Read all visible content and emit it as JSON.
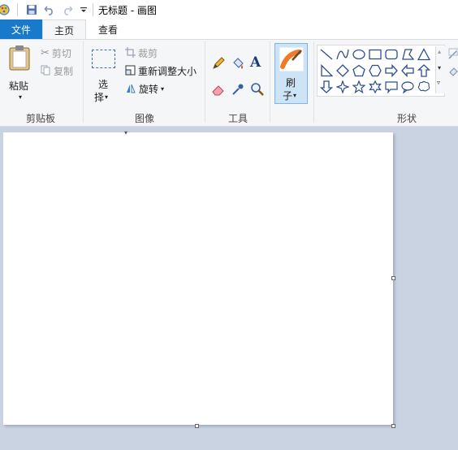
{
  "window": {
    "title": "无标题 - 画图"
  },
  "tabs": {
    "file": "文件",
    "home": "主页",
    "view": "查看"
  },
  "clipboard": {
    "paste": "粘贴",
    "cut": "剪切",
    "copy": "复制",
    "group": "剪贴板"
  },
  "image": {
    "select_line1": "选",
    "select_line2": "择",
    "crop": "裁剪",
    "resize": "重新调整大小",
    "rotate": "旋转",
    "group": "图像"
  },
  "tools": {
    "group": "工具"
  },
  "brushes": {
    "line1": "刷",
    "line2": "子"
  },
  "shapes": {
    "group": "形状"
  },
  "colors": {
    "accent": "#1979ca",
    "canvas": "#ffffff",
    "workspace": "#c9d3e2"
  }
}
